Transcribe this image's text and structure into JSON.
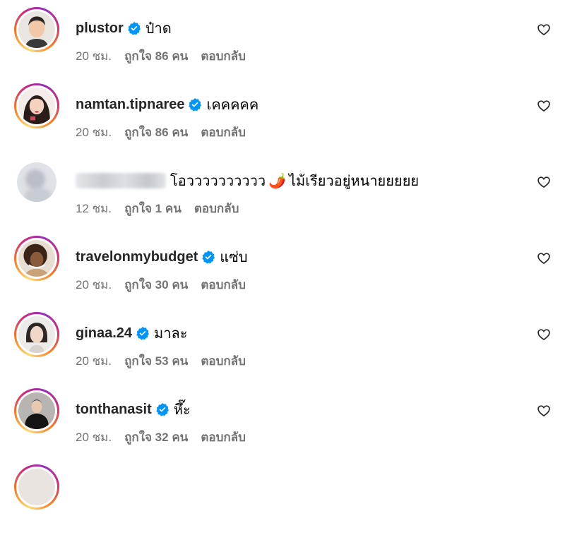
{
  "labels": {
    "likes_prefix": "ถูกใจ",
    "likes_suffix": "คน",
    "reply": "ตอบกลับ"
  },
  "comments": [
    {
      "username": "plustor",
      "verified": true,
      "text": "ป๋าด",
      "time": "20 ชม.",
      "likes": "ถูกใจ 86 คน",
      "reply": "ตอบกลับ",
      "avatar_ring": true
    },
    {
      "username": "namtan.tipnaree",
      "verified": true,
      "text": "เคคคคค",
      "time": "20 ชม.",
      "likes": "ถูกใจ 86 คน",
      "reply": "ตอบกลับ",
      "avatar_ring": true
    },
    {
      "username": "",
      "verified": false,
      "text": "โอวววววววววว",
      "emoji": "🌶️",
      "text2": "ไม้เรียวอยู่หนายยยยย",
      "time": "12 ชม.",
      "likes": "ถูกใจ 1 คน",
      "reply": "ตอบกลับ",
      "avatar_ring": false
    },
    {
      "username": "travelonmybudget",
      "verified": true,
      "text": "แซ่บ",
      "time": "20 ชม.",
      "likes": "ถูกใจ 30 คน",
      "reply": "ตอบกลับ",
      "avatar_ring": true
    },
    {
      "username": "ginaa.24",
      "verified": true,
      "text": "มาละ",
      "time": "20 ชม.",
      "likes": "ถูกใจ 53 คน",
      "reply": "ตอบกลับ",
      "avatar_ring": true
    },
    {
      "username": "tonthanasit",
      "verified": true,
      "text": "หึ๊ะ",
      "time": "20 ชม.",
      "likes": "ถูกใจ 32 คน",
      "reply": "ตอบกลับ",
      "avatar_ring": true
    }
  ],
  "colors": {
    "verified": "#0095f6",
    "meta_text": "#737373",
    "ring_start": "#feda75",
    "ring_end": "#d62976"
  },
  "icons": {
    "verified": "verified-badge-icon",
    "like": "heart-outline-icon"
  }
}
